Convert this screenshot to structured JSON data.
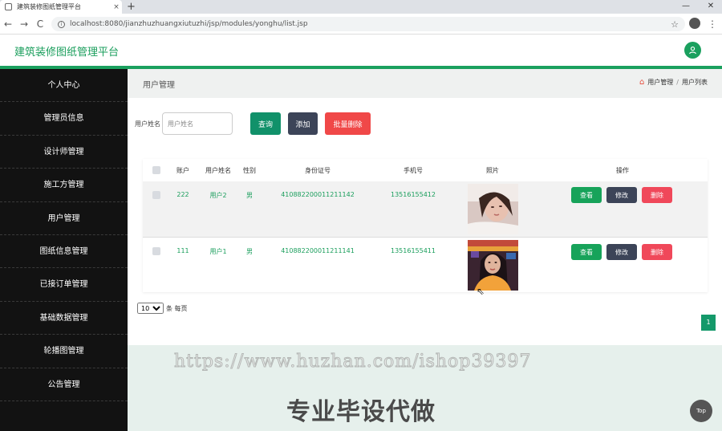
{
  "browser": {
    "tab_title": "建筑装修图纸管理平台",
    "tab_close": "×",
    "new_tab": "+",
    "url": "localhost:8080/jianzhuzhuangxiutuzhi/jsp/modules/yonghu/list.jsp",
    "win_minimize": "—",
    "win_restore": "❐",
    "win_close": "✕",
    "back": "←",
    "forward": "→",
    "reload": "C",
    "star": "☆",
    "menu": "⋮",
    "info": "i"
  },
  "header": {
    "title": "建筑装修图纸管理平台"
  },
  "sidebar": {
    "items": [
      {
        "label": "个人中心"
      },
      {
        "label": "管理员信息"
      },
      {
        "label": "设计师管理"
      },
      {
        "label": "施工方管理"
      },
      {
        "label": "用户管理"
      },
      {
        "label": "图纸信息管理"
      },
      {
        "label": "已接订单管理"
      },
      {
        "label": "基础数据管理"
      },
      {
        "label": "轮播图管理"
      },
      {
        "label": "公告管理"
      }
    ]
  },
  "main": {
    "page_title": "用户管理",
    "breadcrumb": {
      "level1": "用户管理",
      "separator": "/",
      "level2": "用户列表"
    },
    "search": {
      "label": "用户姓名",
      "placeholder": "用户姓名",
      "query_label": "查询",
      "add_label": "添加",
      "batch_delete_label": "批量删除"
    },
    "table": {
      "headers": {
        "account": "账户",
        "name": "用户姓名",
        "gender": "性别",
        "id_card": "身份证号",
        "phone": "手机号",
        "photo": "照片",
        "ops": "操作"
      },
      "rows": [
        {
          "account": "222",
          "name": "用户2",
          "gender": "男",
          "id_card": "410882200011211142",
          "phone": "13516155412"
        },
        {
          "account": "111",
          "name": "用户1",
          "gender": "男",
          "id_card": "410882200011211141",
          "phone": "13516155411"
        }
      ],
      "view_label": "查看",
      "edit_label": "修改",
      "delete_label": "删除"
    },
    "pagination": {
      "page_size": "10",
      "per_page_text": "条 每页",
      "current_page": "1"
    }
  },
  "watermark": {
    "url": "https://www.huzhan.com/ishop39397",
    "text": "专业毕设代做"
  },
  "top_button": "Top",
  "colors": {
    "brand_green": "#1aa05e",
    "sidebar_bg": "#121212",
    "danger": "#f0485a",
    "dark_button": "#3c4458"
  }
}
